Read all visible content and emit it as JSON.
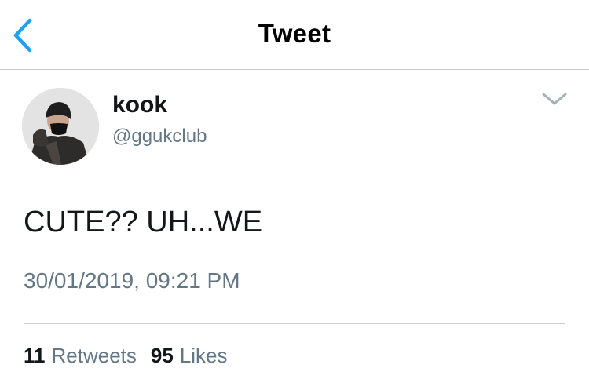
{
  "header": {
    "title": "Tweet",
    "back_icon": "chevron-left-icon",
    "accent_color": "#1da1f2"
  },
  "tweet": {
    "display_name": "kook",
    "handle": "@ggukclub",
    "text": "CUTE?? UH...WE",
    "timestamp": "30/01/2019, 09:21 PM",
    "menu_icon": "chevron-down-icon"
  },
  "stats": {
    "retweets": {
      "count": "11",
      "label": "Retweets"
    },
    "likes": {
      "count": "95",
      "label": "Likes"
    }
  }
}
